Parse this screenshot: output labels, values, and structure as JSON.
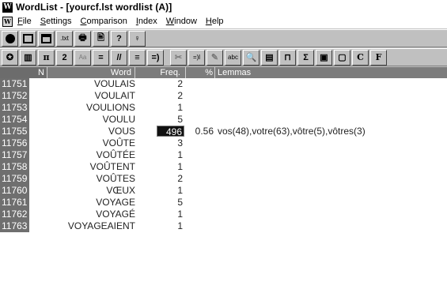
{
  "window": {
    "app_icon": "W",
    "title": "WordList - [yourcf.lst wordlist (A)]"
  },
  "menubar": {
    "system_icon": "W",
    "items": [
      "File",
      "Settings",
      "Comparison",
      "Index",
      "Window",
      "Help"
    ]
  },
  "toolbar1": {
    "buttons": [
      {
        "icon": "record-dot-icon",
        "glyph": ""
      },
      {
        "icon": "save-disk-icon",
        "glyph": ""
      },
      {
        "icon": "save-all-icon",
        "glyph": ""
      },
      {
        "icon": "txt-file-icon",
        "glyph": ".txt"
      },
      {
        "icon": "print-icon",
        "glyph": "🖶"
      },
      {
        "icon": "print-preview-icon",
        "glyph": "🖹"
      },
      {
        "icon": "help-icon",
        "glyph": "?"
      },
      {
        "icon": "lightbulb-icon",
        "glyph": "♀"
      }
    ]
  },
  "toolbar2": {
    "buttons": [
      {
        "icon": "refresh-icon",
        "glyph": "✪"
      },
      {
        "icon": "columns-icon",
        "glyph": "▥"
      },
      {
        "icon": "pi-icon",
        "glyph": "π"
      },
      {
        "icon": "two-icon",
        "glyph": "2"
      },
      {
        "icon": "font-size-icon",
        "glyph": "Aa"
      },
      {
        "icon": "equals-icon",
        "glyph": "="
      },
      {
        "icon": "slash-icon",
        "glyph": "//"
      },
      {
        "icon": "lines-icon",
        "glyph": "≡"
      },
      {
        "icon": "arrow-lines-icon",
        "glyph": "=)"
      },
      {
        "icon": "cut-icon",
        "glyph": "✂"
      },
      {
        "icon": "join-icon",
        "glyph": "=)l"
      },
      {
        "icon": "edit-icon",
        "glyph": "✎"
      },
      {
        "icon": "abc-icon",
        "glyph": "abc"
      },
      {
        "icon": "search-icon",
        "glyph": "🔍"
      },
      {
        "icon": "list-icon",
        "glyph": "▤"
      },
      {
        "icon": "sort-icon",
        "glyph": "⊓"
      },
      {
        "icon": "sigma-icon",
        "glyph": "Σ"
      },
      {
        "icon": "window-icon",
        "glyph": "▣"
      },
      {
        "icon": "page-icon",
        "glyph": "▢"
      },
      {
        "icon": "c-icon",
        "glyph": "C"
      },
      {
        "icon": "f-icon",
        "glyph": "F"
      }
    ]
  },
  "columns": {
    "n": "N",
    "word": "Word",
    "freq": "Freq.",
    "pct": "%",
    "lemmas": "Lemmas"
  },
  "rows": [
    {
      "n": "11751",
      "word": "VOULAIS",
      "freq": "2",
      "pct": "",
      "lemmas": ""
    },
    {
      "n": "11752",
      "word": "VOULAIT",
      "freq": "2",
      "pct": "",
      "lemmas": ""
    },
    {
      "n": "11753",
      "word": "VOULIONS",
      "freq": "1",
      "pct": "",
      "lemmas": ""
    },
    {
      "n": "11754",
      "word": "VOULU",
      "freq": "5",
      "pct": "",
      "lemmas": ""
    },
    {
      "n": "11755",
      "word": "VOUS",
      "freq": "496",
      "pct": "0.56",
      "lemmas": "vos(48),votre(63),vôtre(5),vôtres(3)",
      "selected": true
    },
    {
      "n": "11756",
      "word": "VOÛTE",
      "freq": "3",
      "pct": "",
      "lemmas": ""
    },
    {
      "n": "11757",
      "word": "VOÛTÉE",
      "freq": "1",
      "pct": "",
      "lemmas": ""
    },
    {
      "n": "11758",
      "word": "VOÛTENT",
      "freq": "1",
      "pct": "",
      "lemmas": ""
    },
    {
      "n": "11759",
      "word": "VOÛTES",
      "freq": "2",
      "pct": "",
      "lemmas": ""
    },
    {
      "n": "11760",
      "word": "VŒUX",
      "freq": "1",
      "pct": "",
      "lemmas": ""
    },
    {
      "n": "11761",
      "word": "VOYAGE",
      "freq": "5",
      "pct": "",
      "lemmas": ""
    },
    {
      "n": "11762",
      "word": "VOYAGÉ",
      "freq": "1",
      "pct": "",
      "lemmas": ""
    },
    {
      "n": "11763",
      "word": "VOYAGEAIENT",
      "freq": "1",
      "pct": "",
      "lemmas": ""
    }
  ]
}
